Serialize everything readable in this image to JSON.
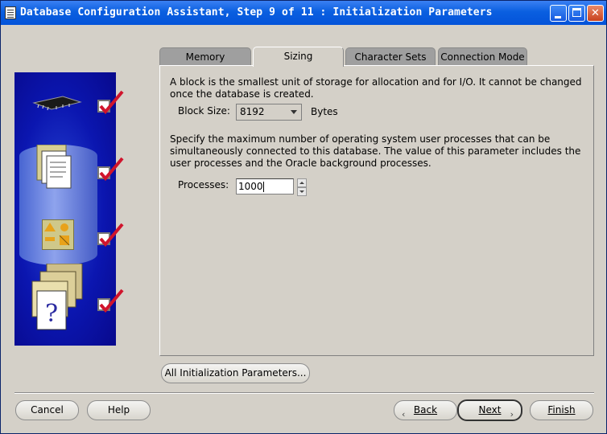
{
  "window": {
    "title": "Database Configuration Assistant, Step 9 of 11 : Initialization Parameters"
  },
  "tabs": [
    {
      "label": "Memory",
      "active": false
    },
    {
      "label": "Sizing",
      "active": true
    },
    {
      "label": "Character Sets",
      "active": false
    },
    {
      "label": "Connection Mode",
      "active": false
    }
  ],
  "sizing": {
    "block_description": "A block is the smallest unit of storage for allocation and for I/O. It cannot be changed once the database is created.",
    "block_size_label": "Block Size:",
    "block_size_value": "8192",
    "block_size_unit": "Bytes",
    "processes_description": "Specify the maximum number of operating system user processes that can be simultaneously connected to this database. The value of this parameter includes the user processes and the Oracle background processes.",
    "processes_label": "Processes:",
    "processes_value": "1000"
  },
  "buttons": {
    "all_params": "All Initialization Parameters...",
    "cancel": "Cancel",
    "help": "Help",
    "back": "Back",
    "next": "Next",
    "finish": "Finish"
  },
  "colors": {
    "titlebar": "#0453d9",
    "dialog_bg": "#d4d0c8",
    "side_panel": "#0b16b0",
    "checkmark": "#d0142c"
  }
}
